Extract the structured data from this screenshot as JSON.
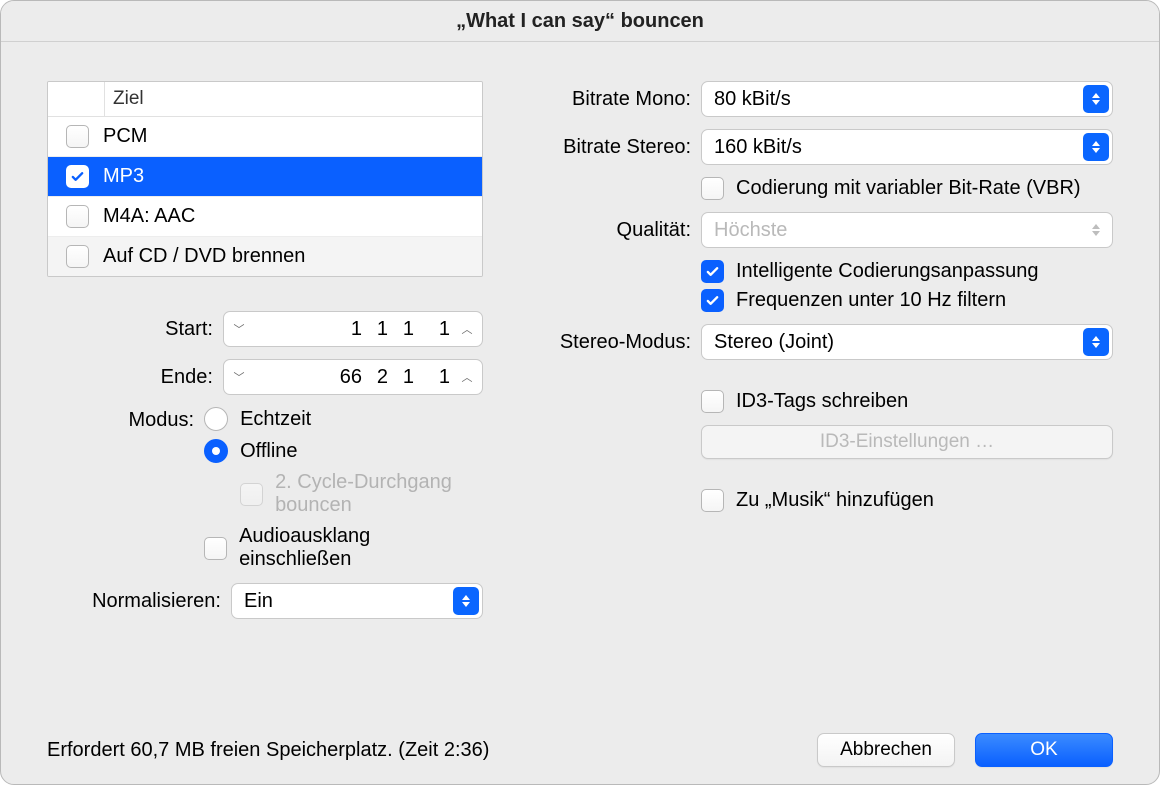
{
  "title": "„What I can say“ bouncen",
  "dest": {
    "header": "Ziel",
    "items": [
      {
        "label": "PCM",
        "checked": false,
        "selected": false
      },
      {
        "label": "MP3",
        "checked": true,
        "selected": true
      },
      {
        "label": "M4A: AAC",
        "checked": false,
        "selected": false
      },
      {
        "label": "Auf CD / DVD brennen",
        "checked": false,
        "selected": false
      }
    ]
  },
  "left": {
    "start_label": "Start:",
    "start_values": [
      "1",
      "1",
      "1",
      "1"
    ],
    "end_label": "Ende:",
    "end_values": [
      "66",
      "2",
      "1",
      "1"
    ],
    "mode_label": "Modus:",
    "mode_realtime": "Echtzeit",
    "mode_offline": "Offline",
    "mode_second_cycle": "2. Cycle-Durchgang bouncen",
    "mode_include_tail": "Audioausklang einschließen",
    "normalize_label": "Normalisieren:",
    "normalize_value": "Ein"
  },
  "right": {
    "bitrate_mono_label": "Bitrate Mono:",
    "bitrate_mono_value": "80 kBit/s",
    "bitrate_stereo_label": "Bitrate Stereo:",
    "bitrate_stereo_value": "160 kBit/s",
    "vbr_label": "Codierung mit variabler Bit-Rate (VBR)",
    "quality_label": "Qualität:",
    "quality_value": "Höchste",
    "smart_encode": "Intelligente Codierungsanpassung",
    "filter_10hz": "Frequenzen unter 10 Hz filtern",
    "stereo_mode_label": "Stereo-Modus:",
    "stereo_mode_value": "Stereo (Joint)",
    "id3_write": "ID3-Tags schreiben",
    "id3_settings": "ID3-Einstellungen …",
    "add_to_music": "Zu „Musik“ hinzufügen"
  },
  "footer": {
    "status": "Erfordert 60,7 MB freien Speicherplatz. (Zeit 2:36)",
    "cancel": "Abbrechen",
    "ok": "OK"
  }
}
